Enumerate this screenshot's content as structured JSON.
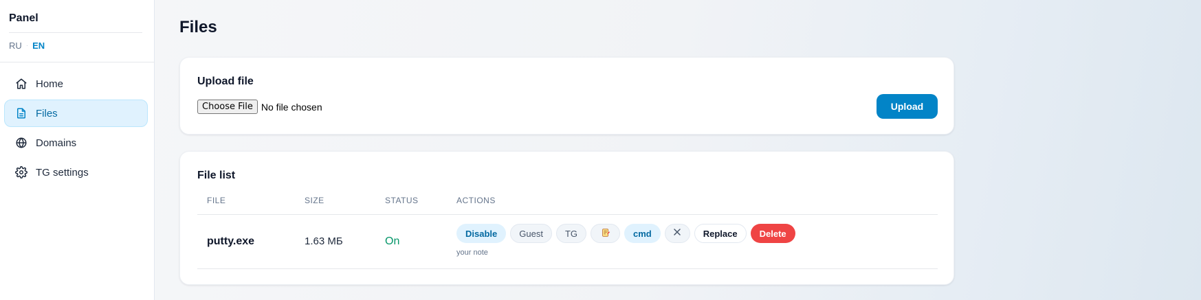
{
  "sidebar": {
    "brand": "Panel",
    "languages": [
      {
        "label": "RU",
        "active": false
      },
      {
        "label": "EN",
        "active": true
      }
    ],
    "items": [
      {
        "label": "Home",
        "icon": "home-icon"
      },
      {
        "label": "Files",
        "icon": "file-icon",
        "active": true
      },
      {
        "label": "Domains",
        "icon": "globe-icon"
      },
      {
        "label": "TG settings",
        "icon": "gear-icon"
      }
    ]
  },
  "page": {
    "title": "Files"
  },
  "upload": {
    "title": "Upload file",
    "choose_label": "Choose File",
    "no_file_label": "No file chosen",
    "submit_label": "Upload"
  },
  "file_list": {
    "title": "File list",
    "columns": [
      "FILE",
      "SIZE",
      "STATUS",
      "ACTIONS"
    ],
    "rows": [
      {
        "name": "putty.exe",
        "size": "1.63 МБ",
        "status": "On",
        "note": "your note",
        "actions": {
          "disable": "Disable",
          "guest": "Guest",
          "tg": "TG",
          "note_icon": "note-icon",
          "cmd": "cmd",
          "close_icon": "close-icon",
          "replace": "Replace",
          "delete": "Delete"
        }
      }
    ]
  },
  "colors": {
    "accent": "#0284c7",
    "status_on": "#059669",
    "danger": "#ef4444"
  }
}
